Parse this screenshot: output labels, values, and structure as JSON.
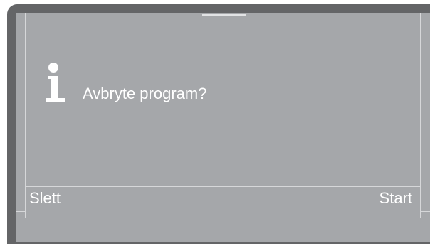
{
  "dialog": {
    "icon": "info-icon",
    "message": "Avbryte program?"
  },
  "softkeys": {
    "left_label": "Slett",
    "right_label": "Start"
  },
  "colors": {
    "screen_background": "#a5a7aa",
    "bezel": "#646567",
    "text": "#ffffff"
  }
}
